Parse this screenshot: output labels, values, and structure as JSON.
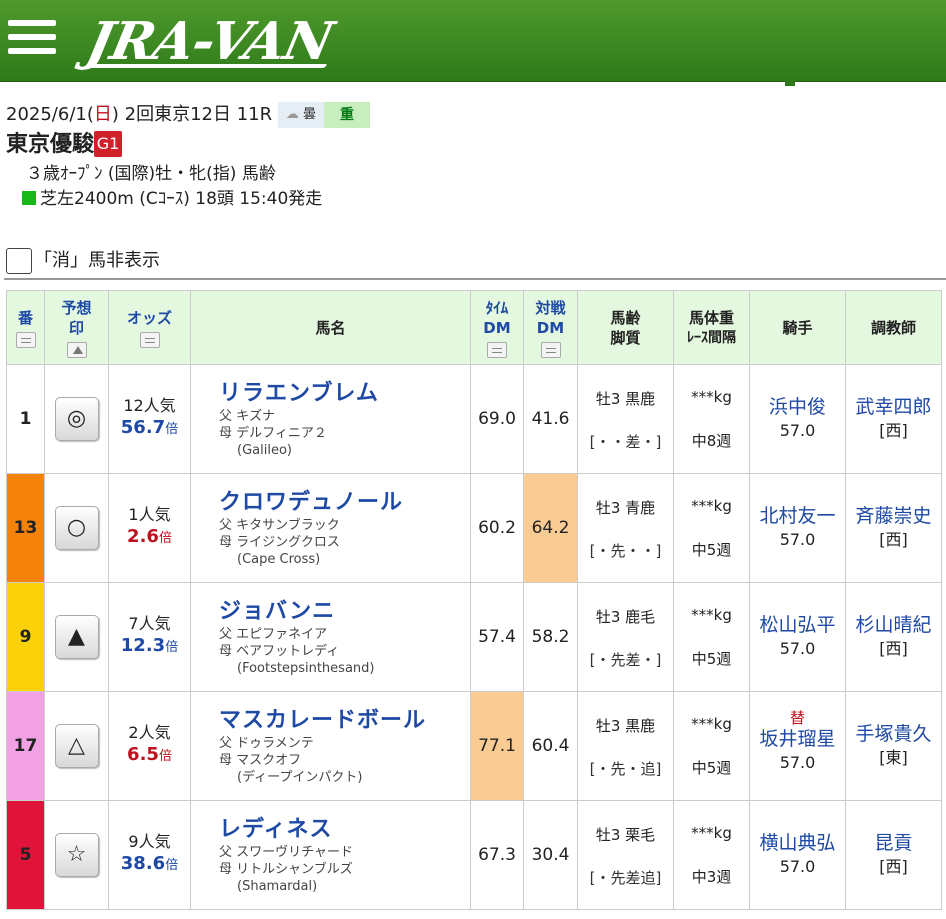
{
  "header": {
    "logo": "JRA-VAN"
  },
  "race": {
    "date_prefix": "2025/6/1(",
    "weekday": "日",
    "date_suffix": ") 2回東京12日 11R",
    "weather": "曇",
    "track_cond": "重",
    "name": "東京優駿",
    "grade": "G1",
    "conditions": "３歳ｵｰﾌﾟﾝ (国際)牡・牝(指) 馬齢",
    "course": "芝左2400m (Cｺｰｽ) 18頭 15:40発走"
  },
  "filter": {
    "label": "「消」馬非表示"
  },
  "table": {
    "headers": {
      "num": "番",
      "mark_l1": "予想",
      "mark_l2": "印",
      "odds": "オッズ",
      "name": "馬名",
      "time_l1": "ﾀｲﾑ",
      "time_l2": "DM",
      "vs_l1": "対戦",
      "vs_l2": "DM",
      "age_l1": "馬齢",
      "age_l2": "脚質",
      "wt_l1": "馬体重",
      "wt_l2": "ﾚｰｽ間隔",
      "jockey": "騎手",
      "trainer": "調教師"
    },
    "rows": [
      {
        "num": "1",
        "num_color": "#ffffff",
        "mark": "◎",
        "pop": "12人気",
        "odds": "56.7",
        "odds_unit": "倍",
        "odds_cls": "hi",
        "name": "リラエンブレム",
        "sire": "父 キズナ",
        "dam": "母 デルフィニア２",
        "damsire": "(Galileo)",
        "time_dm": "69.0",
        "vs_dm": "41.6",
        "time_hi": false,
        "vs_hi": false,
        "sexage": "牡3 黒鹿",
        "legs": "[・・差・]",
        "weight": "***kg",
        "interval": "中8週",
        "sub": "",
        "jockey": "浜中俊",
        "kg": "57.0",
        "trainer": "武幸四郎",
        "area": "[西]"
      },
      {
        "num": "13",
        "num_color": "#f5820a",
        "mark": "○",
        "pop": "1人気",
        "odds": "2.6",
        "odds_unit": "倍",
        "odds_cls": "lo",
        "name": "クロワデュノール",
        "sire": "父 キタサンブラック",
        "dam": "母 ライジングクロス",
        "damsire": "(Cape Cross)",
        "time_dm": "60.2",
        "vs_dm": "64.2",
        "time_hi": false,
        "vs_hi": true,
        "sexage": "牡3 青鹿",
        "legs": "[・先・・]",
        "weight": "***kg",
        "interval": "中5週",
        "sub": "",
        "jockey": "北村友一",
        "kg": "57.0",
        "trainer": "斉藤崇史",
        "area": "[西]"
      },
      {
        "num": "9",
        "num_color": "#fbd10a",
        "mark": "▲",
        "pop": "7人気",
        "odds": "12.3",
        "odds_unit": "倍",
        "odds_cls": "hi",
        "name": "ジョバンニ",
        "sire": "父 エピファネイア",
        "dam": "母 ベアフットレディ",
        "damsire": "(Footstepsinthesand)",
        "time_dm": "57.4",
        "vs_dm": "58.2",
        "time_hi": false,
        "vs_hi": false,
        "sexage": "牡3 鹿毛",
        "legs": "[・先差・]",
        "weight": "***kg",
        "interval": "中5週",
        "sub": "",
        "jockey": "松山弘平",
        "kg": "57.0",
        "trainer": "杉山晴紀",
        "area": "[西]"
      },
      {
        "num": "17",
        "num_color": "#f2a2e4",
        "mark": "△",
        "pop": "2人気",
        "odds": "6.5",
        "odds_unit": "倍",
        "odds_cls": "lo",
        "name": "マスカレードボール",
        "sire": "父 ドゥラメンテ",
        "dam": "母 マスクオフ",
        "damsire": "(ディープインパクト)",
        "time_dm": "77.1",
        "vs_dm": "60.4",
        "time_hi": true,
        "vs_hi": false,
        "sexage": "牡3 黒鹿",
        "legs": "[・先・追]",
        "weight": "***kg",
        "interval": "中5週",
        "sub": "替",
        "jockey": "坂井瑠星",
        "kg": "57.0",
        "trainer": "手塚貴久",
        "area": "[東]"
      },
      {
        "num": "5",
        "num_color": "#e0143a",
        "mark": "☆",
        "pop": "9人気",
        "odds": "38.6",
        "odds_unit": "倍",
        "odds_cls": "hi",
        "name": "レディネス",
        "sire": "父 スワーヴリチャード",
        "dam": "母 リトルシャンブルズ",
        "damsire": "(Shamardal)",
        "time_dm": "67.3",
        "vs_dm": "30.4",
        "time_hi": false,
        "vs_hi": false,
        "sexage": "牡3 栗毛",
        "legs": "[・先差追]",
        "weight": "***kg",
        "interval": "中3週",
        "sub": "",
        "jockey": "横山典弘",
        "kg": "57.0",
        "trainer": "昆貢",
        "area": "[西]"
      }
    ]
  }
}
